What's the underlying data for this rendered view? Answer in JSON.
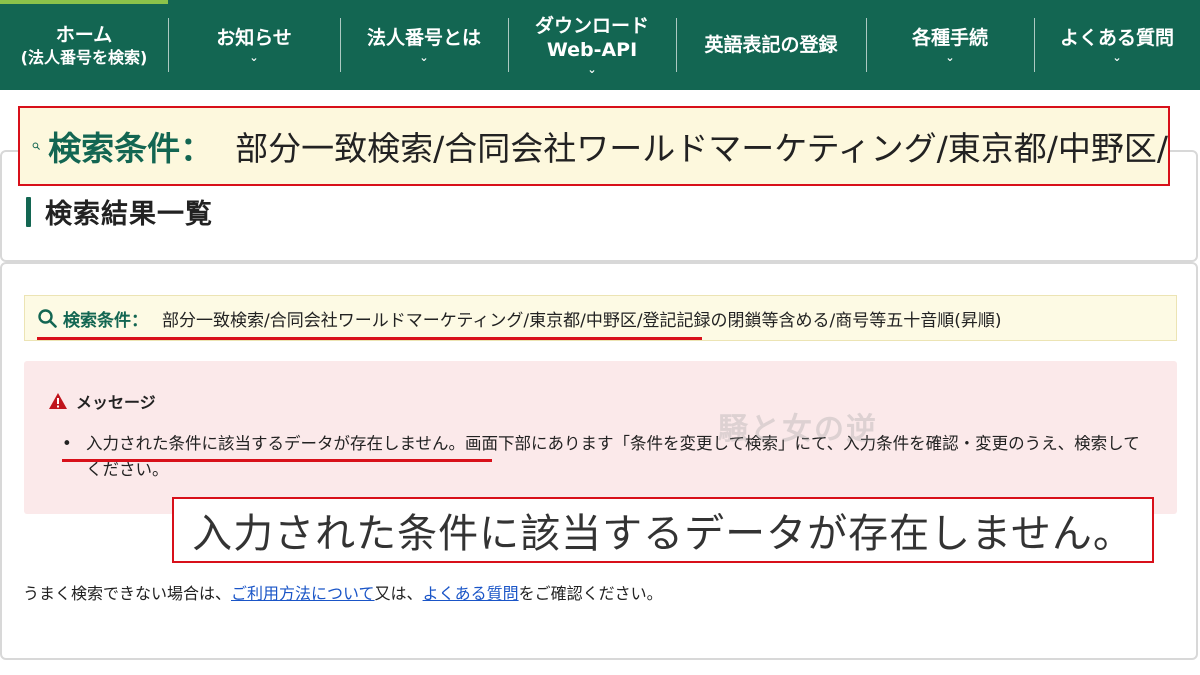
{
  "nav": {
    "items": [
      {
        "lines": [
          "ホーム",
          "(法人番号を検索)"
        ],
        "caret": false
      },
      {
        "lines": [
          "お知らせ"
        ],
        "caret": true
      },
      {
        "lines": [
          "法人番号とは"
        ],
        "caret": true
      },
      {
        "lines": [
          "ダウンロード",
          "Web-API"
        ],
        "caret": true
      },
      {
        "lines": [
          "英語表記の登録"
        ],
        "caret": false
      },
      {
        "lines": [
          "各種手続"
        ],
        "caret": true
      },
      {
        "lines": [
          "よくある質問"
        ],
        "caret": true
      }
    ],
    "caret_glyph": "⌄",
    "bg_color": "#136652"
  },
  "results": {
    "heading": "検索結果一覧",
    "condition_label": "検索条件：",
    "condition_value": "部分一致検索/合同会社ワールドマーケティング/東京都/中野区/登記記録の閉鎖等含める/商号等五十音順(昇順)",
    "zoom_condition_value": "部分一致検索/合同会社ワールドマーケティング/東京都/中野区/"
  },
  "message": {
    "title": "メッセージ",
    "icon": "warning-triangle-icon",
    "items": [
      "入力された条件に該当するデータが存在しません。画面下部にあります「条件を変更して検索」にて、入力条件を確認・変更のうえ、検索してください。"
    ],
    "zoom_text": "入力された条件に該当するデータが存在しません。",
    "watermark": "騒と女の逆"
  },
  "help": {
    "prefix": "うまく検索できない場合は、",
    "link1": "ご利用方法について",
    "middle": "又は、",
    "link2": "よくある質問",
    "suffix": "をご確認ください。"
  },
  "colors": {
    "accent": "#136652",
    "highlight_red": "#d8101a",
    "link": "#1a55c7"
  }
}
